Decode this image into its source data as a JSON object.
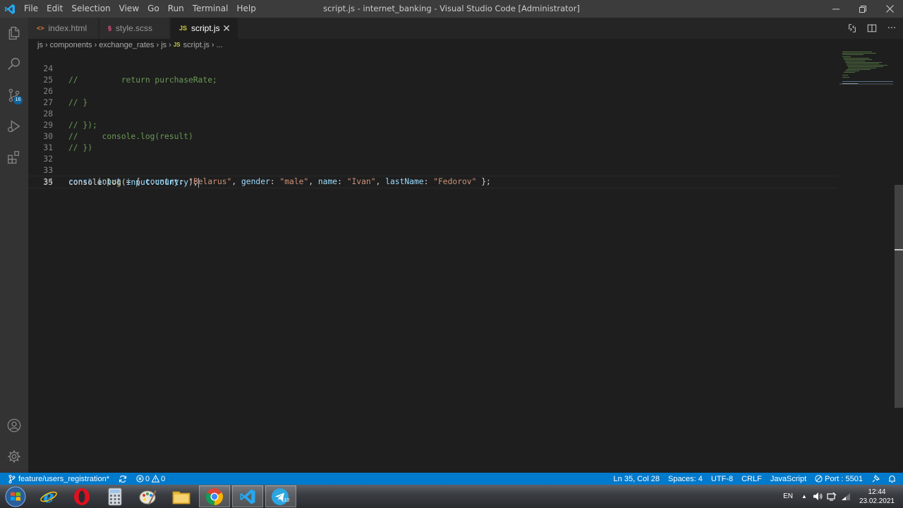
{
  "titlebar": {
    "menu": [
      "File",
      "Edit",
      "Selection",
      "View",
      "Go",
      "Run",
      "Terminal",
      "Help"
    ],
    "window_title": "script.js - internet_banking - Visual Studio Code [Administrator]"
  },
  "activity": {
    "scm_badge": "16"
  },
  "tabs": [
    {
      "label": "index.html",
      "icon": "html-icon",
      "active": false
    },
    {
      "label": "style.scss",
      "icon": "scss-icon",
      "active": false
    },
    {
      "label": "script.js",
      "icon": "js-icon",
      "active": true
    }
  ],
  "tab_icons": {
    "html": "<>",
    "scss": "§",
    "js": "JS"
  },
  "breadcrumb": [
    "js",
    "components",
    "exchange_rates",
    "js",
    "script.js",
    "..."
  ],
  "editor": {
    "lines": [
      {
        "n": "24",
        "text": "//         return purchaseRate;"
      },
      {
        "n": "25",
        "text": ""
      },
      {
        "n": "26",
        "text": "// }"
      },
      {
        "n": "27",
        "text": ""
      },
      {
        "n": "28",
        "text": "// });"
      },
      {
        "n": "29",
        "text": "//     console.log(result)"
      },
      {
        "n": "30",
        "text": "// })"
      },
      {
        "n": "31",
        "text": ""
      },
      {
        "n": "32",
        "text": ""
      },
      {
        "n": "33",
        "text": "const input = { country: \"Belarus\", gender: \"male\", name: \"Ivan\", lastName: \"Fedorov\" };"
      },
      {
        "n": "34",
        "text": ""
      },
      {
        "n": "35",
        "text": "console.log(input.country);"
      }
    ]
  },
  "statusbar": {
    "branch": "feature/users_registration*",
    "errors": "0",
    "warnings": "0",
    "position": "Ln 35, Col 28",
    "spaces": "Spaces: 4",
    "encoding": "UTF-8",
    "eol": "CRLF",
    "language": "JavaScript",
    "port": "Port : 5501"
  },
  "taskbar": {
    "lang": "EN",
    "time": "12:44",
    "date": "23.02.2021",
    "telegram_badge": "110"
  },
  "colors": {
    "accent": "#007acc",
    "comment": "#6a9955",
    "keyword": "#569cd6",
    "variable": "#9cdcfe",
    "string": "#ce9178",
    "function": "#dcdcaa"
  }
}
